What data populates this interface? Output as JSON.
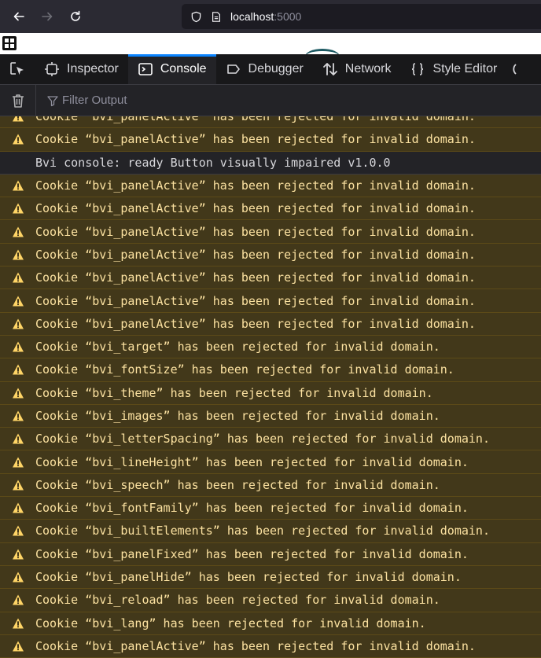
{
  "browser": {
    "url_host": "localhost",
    "url_port": ":5000"
  },
  "devtools": {
    "tabs": [
      {
        "label": "Inspector",
        "icon": "inspector-icon"
      },
      {
        "label": "Console",
        "icon": "console-icon",
        "active": true
      },
      {
        "label": "Debugger",
        "icon": "debugger-icon"
      },
      {
        "label": "Network",
        "icon": "network-icon"
      },
      {
        "label": "Style Editor",
        "icon": "style-editor-icon"
      }
    ]
  },
  "console": {
    "filter_placeholder": "Filter Output",
    "messages": [
      {
        "level": "warning",
        "text": "Cookie “bvi_panelActive” has been rejected for invalid domain."
      },
      {
        "level": "warning",
        "text": "Cookie “bvi_panelActive” has been rejected for invalid domain."
      },
      {
        "level": "log",
        "text": "Bvi console: ready Button visually impaired v1.0.0"
      },
      {
        "level": "warning",
        "text": "Cookie “bvi_panelActive” has been rejected for invalid domain."
      },
      {
        "level": "warning",
        "text": "Cookie “bvi_panelActive” has been rejected for invalid domain."
      },
      {
        "level": "warning",
        "text": "Cookie “bvi_panelActive” has been rejected for invalid domain."
      },
      {
        "level": "warning",
        "text": "Cookie “bvi_panelActive” has been rejected for invalid domain."
      },
      {
        "level": "warning",
        "text": "Cookie “bvi_panelActive” has been rejected for invalid domain."
      },
      {
        "level": "warning",
        "text": "Cookie “bvi_panelActive” has been rejected for invalid domain."
      },
      {
        "level": "warning",
        "text": "Cookie “bvi_panelActive” has been rejected for invalid domain."
      },
      {
        "level": "warning",
        "text": "Cookie “bvi_target” has been rejected for invalid domain."
      },
      {
        "level": "warning",
        "text": "Cookie “bvi_fontSize” has been rejected for invalid domain."
      },
      {
        "level": "warning",
        "text": "Cookie “bvi_theme” has been rejected for invalid domain."
      },
      {
        "level": "warning",
        "text": "Cookie “bvi_images” has been rejected for invalid domain."
      },
      {
        "level": "warning",
        "text": "Cookie “bvi_letterSpacing” has been rejected for invalid domain."
      },
      {
        "level": "warning",
        "text": "Cookie “bvi_lineHeight” has been rejected for invalid domain."
      },
      {
        "level": "warning",
        "text": "Cookie “bvi_speech” has been rejected for invalid domain."
      },
      {
        "level": "warning",
        "text": "Cookie “bvi_fontFamily” has been rejected for invalid domain."
      },
      {
        "level": "warning",
        "text": "Cookie “bvi_builtElements” has been rejected for invalid domain."
      },
      {
        "level": "warning",
        "text": "Cookie “bvi_panelFixed” has been rejected for invalid domain."
      },
      {
        "level": "warning",
        "text": "Cookie “bvi_panelHide” has been rejected for invalid domain."
      },
      {
        "level": "warning",
        "text": "Cookie “bvi_reload” has been rejected for invalid domain."
      },
      {
        "level": "warning",
        "text": "Cookie “bvi_lang” has been rejected for invalid domain."
      },
      {
        "level": "warning",
        "text": "Cookie “bvi_panelActive” has been rejected for invalid domain."
      }
    ]
  },
  "colors": {
    "warning_bg": "#42381a",
    "warning_text": "#fce2a1",
    "warning_icon": "#ffd567",
    "active_tab_accent": "#0a84ff"
  }
}
